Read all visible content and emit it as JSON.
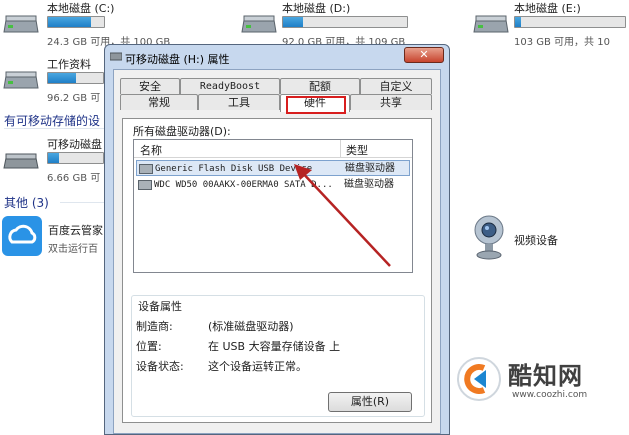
{
  "explorer": {
    "drives": [
      {
        "name": "本地磁盘 (C:)",
        "space": "24.3 GB 可用，共 100 GB",
        "used_fraction": 0.76
      },
      {
        "name": "本地磁盘 (D:)",
        "space": "92.0 GB 可用，共 109 GB",
        "used_fraction": 0.16
      },
      {
        "name": "本地磁盘 (E:)",
        "space": "103 GB 可用，共 10",
        "used_fraction": 0.05
      },
      {
        "name": "工作资料",
        "space": "96.2 GB 可",
        "used_fraction": 0.5
      }
    ],
    "removable_section": "有可移动存储的设",
    "removable": {
      "name": "可移动磁盘",
      "space": "6.66 GB 可"
    },
    "other_section": "其他 (3)",
    "other_items": [
      {
        "name": "百度云管家",
        "sub": "双击运行百"
      },
      {
        "name": "视频设备",
        "sub": ""
      }
    ]
  },
  "dialog": {
    "title": "可移动磁盘 (H:) 属性",
    "close": "✕",
    "tabs_row1": [
      "安全",
      "ReadyBoost",
      "配额",
      "自定义"
    ],
    "tabs_row2": [
      "常规",
      "工具",
      "硬件",
      "共享"
    ],
    "active_tab": "硬件",
    "list_caption": "所有磁盘驱动器(D):",
    "list_headers": [
      "名称",
      "类型"
    ],
    "list_rows": [
      {
        "name": "Generic Flash Disk USB Device",
        "type": "磁盘驱动器"
      },
      {
        "name": "WDC WD50 00AAKX-00ERMA0 SATA D...",
        "type": "磁盘驱动器"
      }
    ],
    "props_title": "设备属性",
    "props": [
      {
        "label": "制造商:",
        "value": "(标准磁盘驱动器)"
      },
      {
        "label": "位置:",
        "value": "在 USB 大容量存储设备 上"
      },
      {
        "label": "设备状态:",
        "value": "这个设备运转正常。"
      }
    ],
    "properties_button": "属性(R)"
  },
  "watermark": {
    "brand": "酷知网",
    "url": "www.coozhi.com"
  },
  "colors": {
    "accent_red": "#d81e1e",
    "drive_bar": "#2a8ad4",
    "dialog_frame": "#c7d8ee"
  }
}
